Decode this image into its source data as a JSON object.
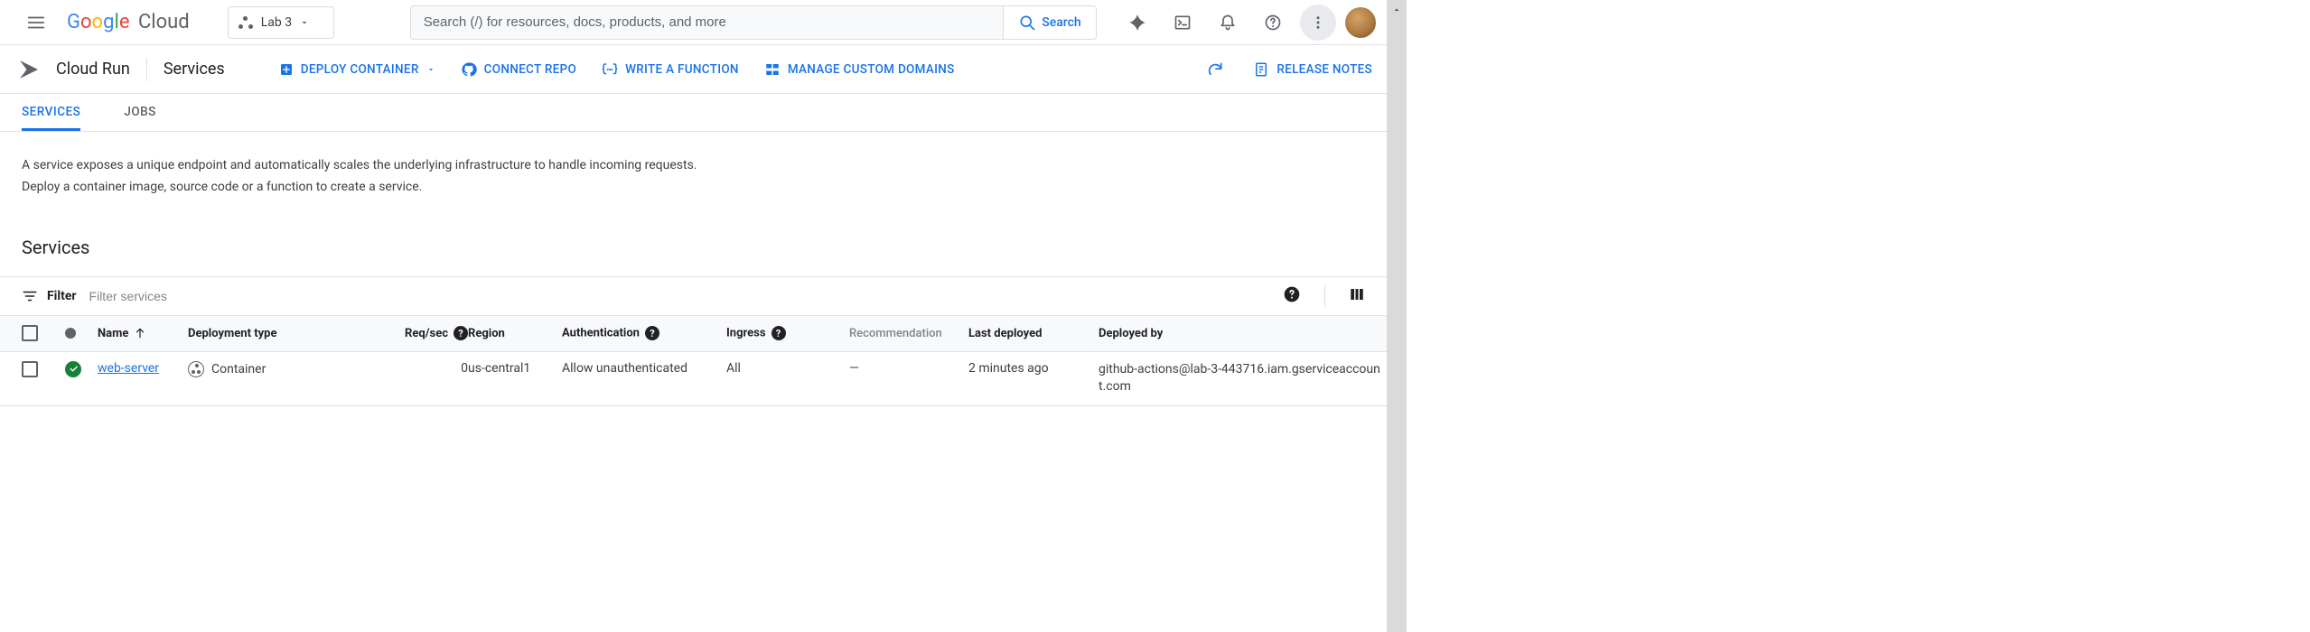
{
  "header": {
    "project_name": "Lab 3",
    "search_placeholder": "Search (/) for resources, docs, products, and more",
    "search_button": "Search"
  },
  "subheader": {
    "product": "Cloud Run",
    "page_title": "Services",
    "actions": {
      "deploy": "DEPLOY CONTAINER",
      "connect_repo": "CONNECT REPO",
      "write_function": "WRITE A FUNCTION",
      "manage_domains": "MANAGE CUSTOM DOMAINS",
      "release_notes": "RELEASE NOTES"
    }
  },
  "tabs": {
    "services": "SERVICES",
    "jobs": "JOBS"
  },
  "content": {
    "desc_line1": "A service exposes a unique endpoint and automatically scales the underlying infrastructure to handle incoming requests.",
    "desc_line2": "Deploy a container image, source code or a function to create a service.",
    "section_title": "Services",
    "filter_label": "Filter",
    "filter_placeholder": "Filter services"
  },
  "table": {
    "columns": {
      "name": "Name",
      "deployment_type": "Deployment type",
      "req_sec": "Req/sec",
      "region": "Region",
      "authentication": "Authentication",
      "ingress": "Ingress",
      "recommendation": "Recommendation",
      "last_deployed": "Last deployed",
      "deployed_by": "Deployed by"
    },
    "rows": [
      {
        "name": "web-server",
        "deployment_type": "Container",
        "req_sec": "0",
        "region": "us-central1",
        "authentication": "Allow unauthenticated",
        "ingress": "All",
        "recommendation": "—",
        "last_deployed": "2 minutes ago",
        "deployed_by": "github-actions@lab-3-443716.iam.gserviceaccount.com"
      }
    ]
  }
}
